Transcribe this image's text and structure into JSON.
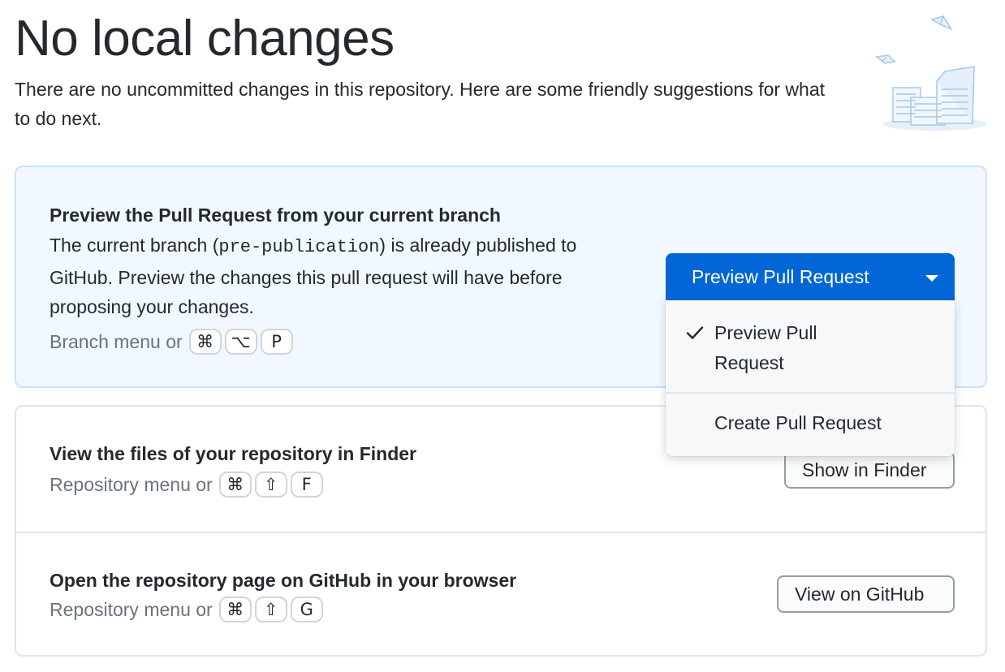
{
  "header": {
    "title": "No local changes",
    "subtitle": "There are no uncommitted changes in this repository. Here are some friendly suggestions for what to do next."
  },
  "cards": {
    "pull_request": {
      "title": "Preview the Pull Request from your current branch",
      "desc_before": "The current branch (",
      "branch": "pre-publication",
      "desc_after": ") is already published to GitHub. Preview the changes this pull request will have before proposing your changes.",
      "shortcut_label": "Branch menu or",
      "keys": [
        "⌘",
        "⌥",
        "P"
      ],
      "button_label": "Preview Pull Request",
      "dropdown": [
        {
          "label": "Preview Pull Request",
          "checked": true
        },
        {
          "label": "Create Pull Request",
          "checked": false
        }
      ]
    },
    "finder": {
      "title": "View the files of your repository in Finder",
      "shortcut_label": "Repository menu or",
      "keys": [
        "⌘",
        "⇧",
        "F"
      ],
      "button_label": "Show in Finder"
    },
    "github": {
      "title": "Open the repository page on GitHub in your browser",
      "shortcut_label": "Repository menu or",
      "keys": [
        "⌘",
        "⇧",
        "G"
      ],
      "button_label": "View on GitHub"
    }
  },
  "colors": {
    "primary": "#0366d6",
    "primary_card_bg": "#f1f8ff",
    "border": "#e1e4e8",
    "muted_text": "#6a737d"
  },
  "icons": {
    "illustration": "empty-repo-illustration",
    "dropdown_caret": "caret-down-icon",
    "check": "check-icon"
  }
}
